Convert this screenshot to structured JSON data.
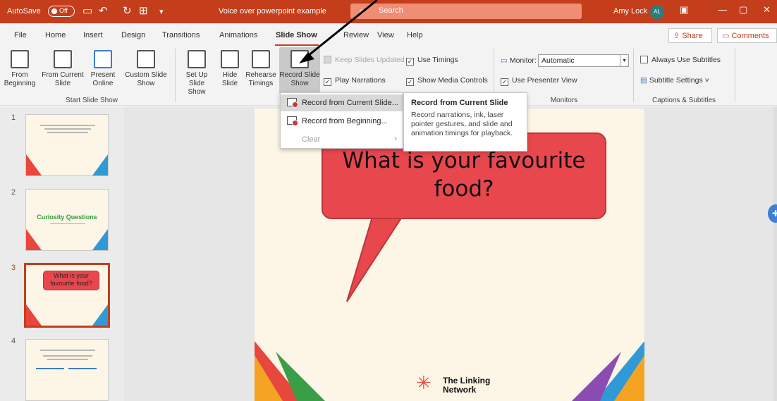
{
  "titlebar": {
    "autosave_label": "AutoSave",
    "autosave_state": "Off",
    "doc_title": "Voice over powerpoint example",
    "search_placeholder": "Search",
    "user_name": "Amy Lock",
    "user_initials": "AL",
    "color": "#c43e1c"
  },
  "tabs": [
    {
      "label": "File"
    },
    {
      "label": "Home"
    },
    {
      "label": "Insert"
    },
    {
      "label": "Design"
    },
    {
      "label": "Transitions"
    },
    {
      "label": "Animations"
    },
    {
      "label": "Slide Show",
      "active": true
    },
    {
      "label": "Review"
    },
    {
      "label": "View"
    },
    {
      "label": "Help"
    }
  ],
  "share_label": "Share",
  "comments_label": "Comments",
  "ribbon": {
    "from_beginning": "From Beginning",
    "from_current": "From Current Slide",
    "present_online": "Present Online",
    "custom_show": "Custom Slide Show",
    "group_start": "Start Slide Show",
    "setup": "Set Up Slide Show",
    "hide": "Hide Slide",
    "rehearse": "Rehearse Timings",
    "record": "Record Slide Show",
    "keep_updated": "Keep Slides Updated",
    "play_narrations": "Play Narrations",
    "use_timings": "Use Timings",
    "show_media": "Show Media Controls",
    "monitor_label": "Monitor:",
    "monitor_value": "Automatic",
    "presenter_view": "Use Presenter View",
    "group_monitors": "Monitors",
    "always_subtitles": "Always Use Subtitles",
    "subtitle_settings": "Subtitle Settings",
    "group_captions": "Captions & Subtitles"
  },
  "dropdown": {
    "items": [
      {
        "label": "Record from Current Slide..."
      },
      {
        "label": "Record from Beginning..."
      },
      {
        "label": "Clear"
      }
    ]
  },
  "tooltip": {
    "title": "Record from Current Slide",
    "body": "Record narrations, ink, laser pointer gestures, and slide and animation timings for playback."
  },
  "thumbnails": [
    {
      "number": "1"
    },
    {
      "number": "2",
      "title": "Curiosity Questions"
    },
    {
      "number": "3",
      "title": "What is your favourite food?"
    },
    {
      "number": "4"
    }
  ],
  "slide": {
    "bubble_text": "What is your favourite food?",
    "logo_line1": "The Linking",
    "logo_line2": "Network",
    "bubble_color": "#e8474d",
    "background_color": "#fdf5e6"
  }
}
